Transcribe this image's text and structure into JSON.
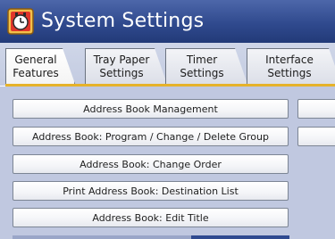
{
  "header": {
    "title": "System Settings"
  },
  "tabs": [
    {
      "label": "General\nFeatures",
      "active": true
    },
    {
      "label": "Tray Paper\nSettings",
      "active": false
    },
    {
      "label": "Timer\nSettings",
      "active": false
    },
    {
      "label": "Interface\nSettings",
      "active": false
    }
  ],
  "buttons": [
    {
      "label": "Address Book Management"
    },
    {
      "label": "Address Book: Program / Change / Delete Group"
    },
    {
      "label": "Address Book: Change Order"
    },
    {
      "label": "Print Address Book: Destination List"
    },
    {
      "label": "Address Book: Edit Title"
    }
  ],
  "colors": {
    "header": "#304a8e",
    "tab_band": "#c3cbe1",
    "active_tab_underline": "#e6b22a",
    "content_bg": "#c0c8e0"
  }
}
